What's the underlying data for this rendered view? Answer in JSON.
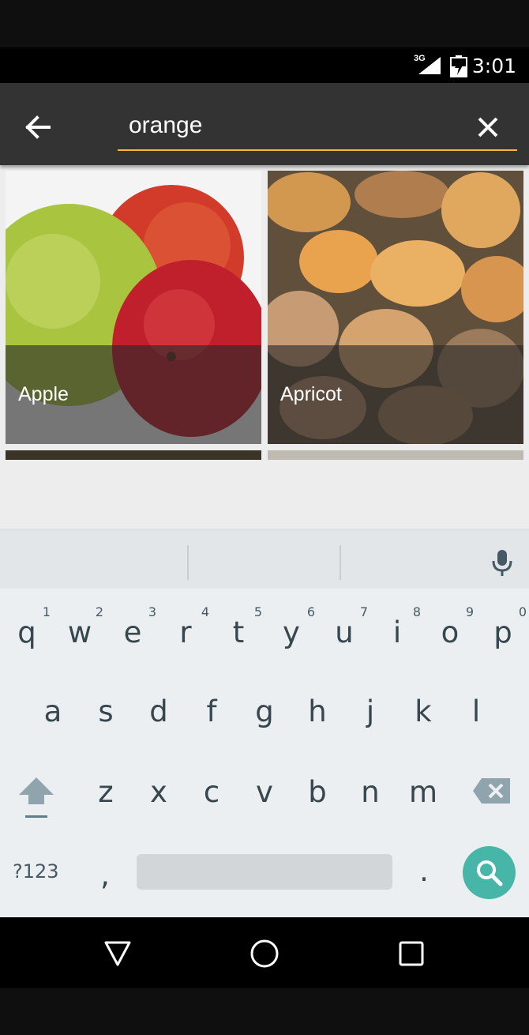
{
  "status_bar": {
    "network": "3G",
    "time": "3:01"
  },
  "search": {
    "query": "orange",
    "back_icon": "arrow-left-icon",
    "clear_icon": "close-icon"
  },
  "results": [
    {
      "label": "Apple"
    },
    {
      "label": "Apricot"
    }
  ],
  "keyboard": {
    "row1": [
      {
        "key": "q",
        "hint": "1"
      },
      {
        "key": "w",
        "hint": "2"
      },
      {
        "key": "e",
        "hint": "3"
      },
      {
        "key": "r",
        "hint": "4"
      },
      {
        "key": "t",
        "hint": "5"
      },
      {
        "key": "y",
        "hint": "6"
      },
      {
        "key": "u",
        "hint": "7"
      },
      {
        "key": "i",
        "hint": "8"
      },
      {
        "key": "o",
        "hint": "9"
      },
      {
        "key": "p",
        "hint": "0"
      }
    ],
    "row2": [
      "a",
      "s",
      "d",
      "f",
      "g",
      "h",
      "j",
      "k",
      "l"
    ],
    "row3": [
      "z",
      "x",
      "c",
      "v",
      "b",
      "n",
      "m"
    ],
    "symbols_label": "?123",
    "comma": ",",
    "period": ".",
    "accent_color": "#47b6a9"
  },
  "colors": {
    "toolbar": "#333333",
    "search_underline": "#f5b82e"
  }
}
